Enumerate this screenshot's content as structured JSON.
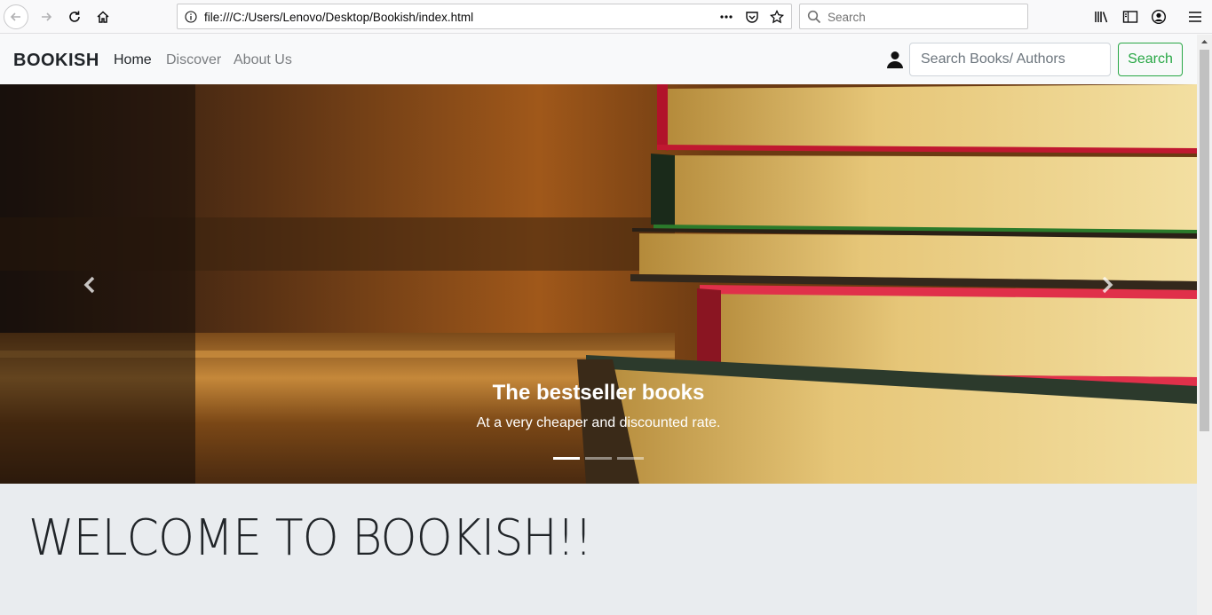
{
  "browser": {
    "url": "file:///C:/Users/Lenovo/Desktop/Bookish/index.html",
    "search_placeholder": "Search"
  },
  "site": {
    "brand": "BOOKISH",
    "nav": [
      {
        "label": "Home"
      },
      {
        "label": "Discover"
      },
      {
        "label": "About Us"
      }
    ],
    "search_placeholder": "Search Books/ Authors",
    "search_button": "Search"
  },
  "carousel": {
    "title": "The bestseller books",
    "subtitle": "At a very cheaper and discounted rate.",
    "slide_count": 3,
    "active_slide": 1
  },
  "jumbotron": {
    "heading": "WELCOME TO BOOKISH!!"
  },
  "colors": {
    "accent_green": "#28a745"
  }
}
